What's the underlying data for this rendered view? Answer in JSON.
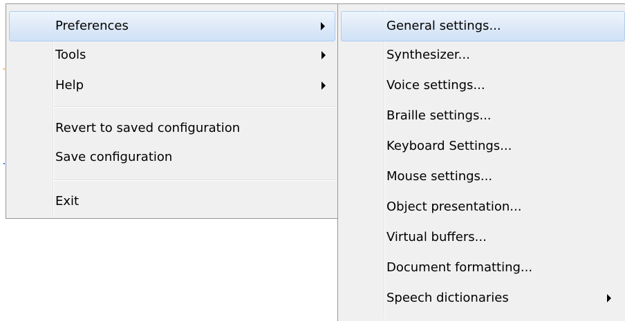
{
  "main_menu": {
    "items": [
      {
        "label": "Preferences"
      },
      {
        "label": "Tools"
      },
      {
        "label": "Help"
      },
      {
        "label": "Revert to saved configuration"
      },
      {
        "label": "Save configuration"
      },
      {
        "label": "Exit"
      }
    ]
  },
  "preferences_submenu": {
    "items": [
      {
        "label": "General settings..."
      },
      {
        "label": "Synthesizer..."
      },
      {
        "label": "Voice settings..."
      },
      {
        "label": "Braille settings..."
      },
      {
        "label": "Keyboard Settings..."
      },
      {
        "label": "Mouse settings..."
      },
      {
        "label": "Object presentation..."
      },
      {
        "label": "Virtual buffers..."
      },
      {
        "label": "Document formatting..."
      },
      {
        "label": "Speech dictionaries"
      }
    ]
  },
  "colors": {
    "menu_background": "#f0f0f0",
    "menu_border": "#979797",
    "highlight_border": "#aeccf0",
    "highlight_fill": "#dde9f7"
  },
  "icons": {
    "submenu_arrow": "triangle-right"
  }
}
